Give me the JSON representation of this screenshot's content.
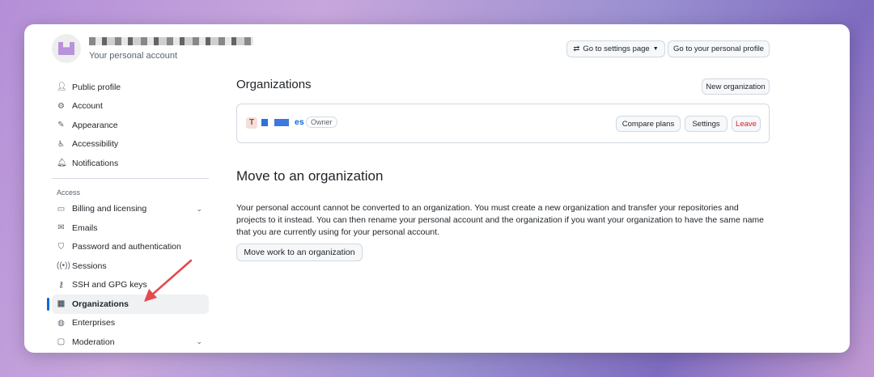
{
  "header": {
    "account_subtitle": "Your personal account",
    "settings_button": "Go to settings page",
    "profile_button": "Go to your personal profile"
  },
  "sidebar": {
    "items": [
      {
        "label": "Public profile",
        "icon": "person-icon"
      },
      {
        "label": "Account",
        "icon": "gear-icon"
      },
      {
        "label": "Appearance",
        "icon": "paintbrush-icon"
      },
      {
        "label": "Accessibility",
        "icon": "accessibility-icon"
      },
      {
        "label": "Notifications",
        "icon": "bell-icon"
      }
    ],
    "group_label": "Access",
    "access_items": [
      {
        "label": "Billing and licensing",
        "icon": "credit-card-icon"
      },
      {
        "label": "Emails",
        "icon": "mail-icon"
      },
      {
        "label": "Password and authentication",
        "icon": "shield-icon"
      },
      {
        "label": "Sessions",
        "icon": "broadcast-icon"
      },
      {
        "label": "SSH and GPG keys",
        "icon": "key-icon"
      },
      {
        "label": "Organizations",
        "icon": "organization-icon"
      },
      {
        "label": "Enterprises",
        "icon": "globe-icon"
      },
      {
        "label": "Moderation",
        "icon": "report-icon"
      }
    ]
  },
  "main": {
    "title": "Organizations",
    "new_org": "New organization",
    "org": {
      "name_suffix": "es",
      "role": "Owner",
      "compare": "Compare plans",
      "settings": "Settings",
      "leave": "Leave"
    },
    "move_title": "Move to an organization",
    "move_text": "Your personal account cannot be converted to an organization. You must create a new organization and transfer your repositories and projects to it instead. You can then rename your personal account and the organization if you want your organization to have the same name that you are currently using for your personal account.",
    "move_button": "Move work to an organization"
  },
  "colors": {
    "accent": "#0969da",
    "danger": "#cf222e",
    "arrow": "#e5484d"
  }
}
